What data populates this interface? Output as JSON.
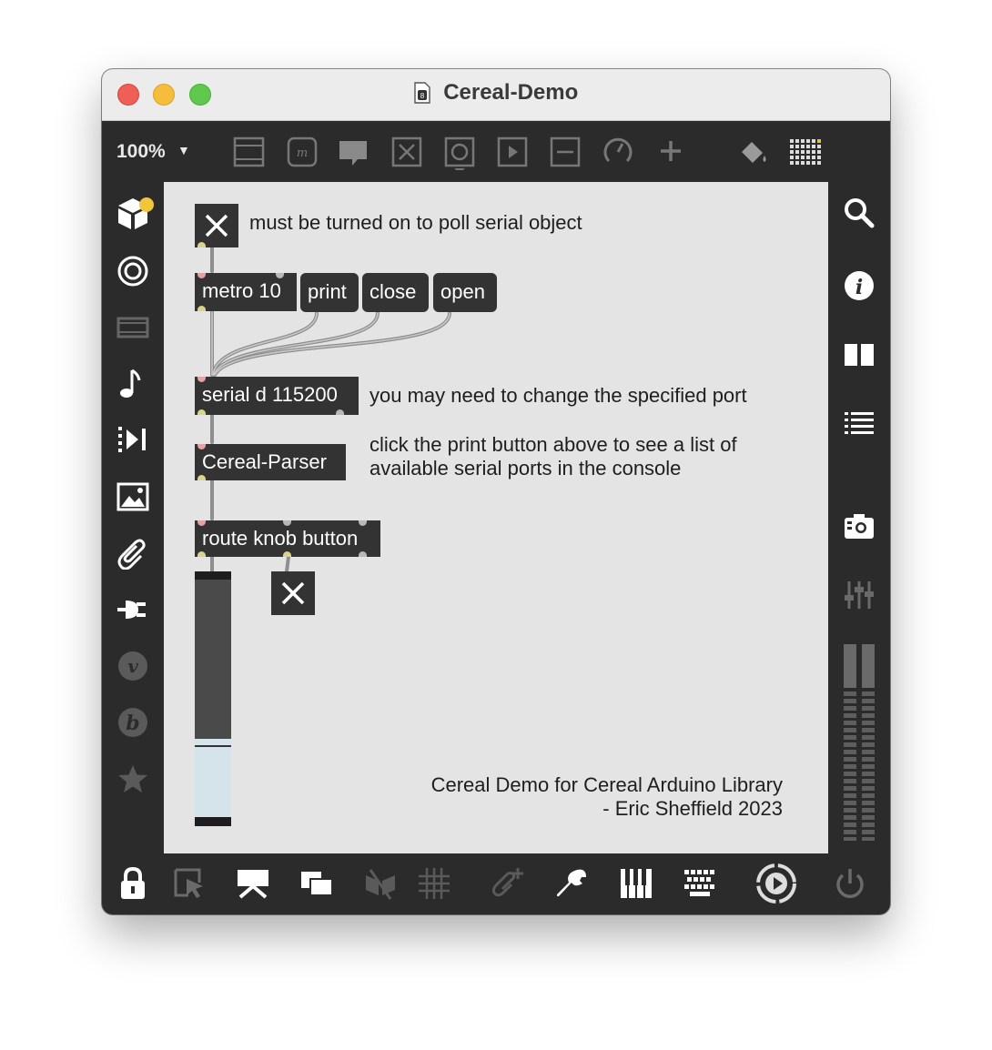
{
  "window": {
    "title": "Cereal-Demo"
  },
  "toolbar": {
    "zoom": "100%",
    "icons": [
      "newobject-icon",
      "message-icon",
      "comment-icon",
      "toggle-icon",
      "button-icon",
      "number-icon",
      "slider-icon",
      "dial-icon",
      "add-icon",
      "paint-bucket-icon",
      "grid-palette-icon"
    ]
  },
  "left_sidebar": {
    "icons": [
      "package-icon",
      "target-icon",
      "media-icon",
      "music-icon",
      "step-icon",
      "image-icon",
      "paperclip-icon",
      "plug-icon",
      "v-icon",
      "b-icon",
      "star-icon"
    ]
  },
  "right_sidebar": {
    "icons": [
      "search-icon",
      "info-icon",
      "book-icon",
      "list-icon",
      "snapshot-icon",
      "mixer-icon",
      "level-meter"
    ]
  },
  "bottom_bar": {
    "icons": [
      "lock-icon",
      "edit-select-icon",
      "presentation-icon",
      "windows-icon",
      "hide-icon",
      "grid-icon",
      "clip-add-icon",
      "wrench-icon",
      "piano-icon",
      "keyboard-icon",
      "play-icon",
      "power-icon"
    ]
  },
  "patch": {
    "comments": {
      "toggle_note": "must be turned on to poll serial object",
      "port_note": "you may need to change the specified port",
      "print_note_1": "click the print button above to see a list of",
      "print_note_2": "available serial ports in the console",
      "credit_1": "Cereal Demo for Cereal Arduino Library",
      "credit_2": "- Eric Sheffield 2023"
    },
    "objects": {
      "metro": "metro 10",
      "serial": "serial d 115200",
      "parser": "Cereal-Parser",
      "route": "route knob button"
    },
    "messages": {
      "print": "print",
      "close": "close",
      "open": "open"
    },
    "toggles": {
      "top_toggle": "on",
      "button_toggle": "on"
    },
    "knob_slider_value": 0.33
  }
}
